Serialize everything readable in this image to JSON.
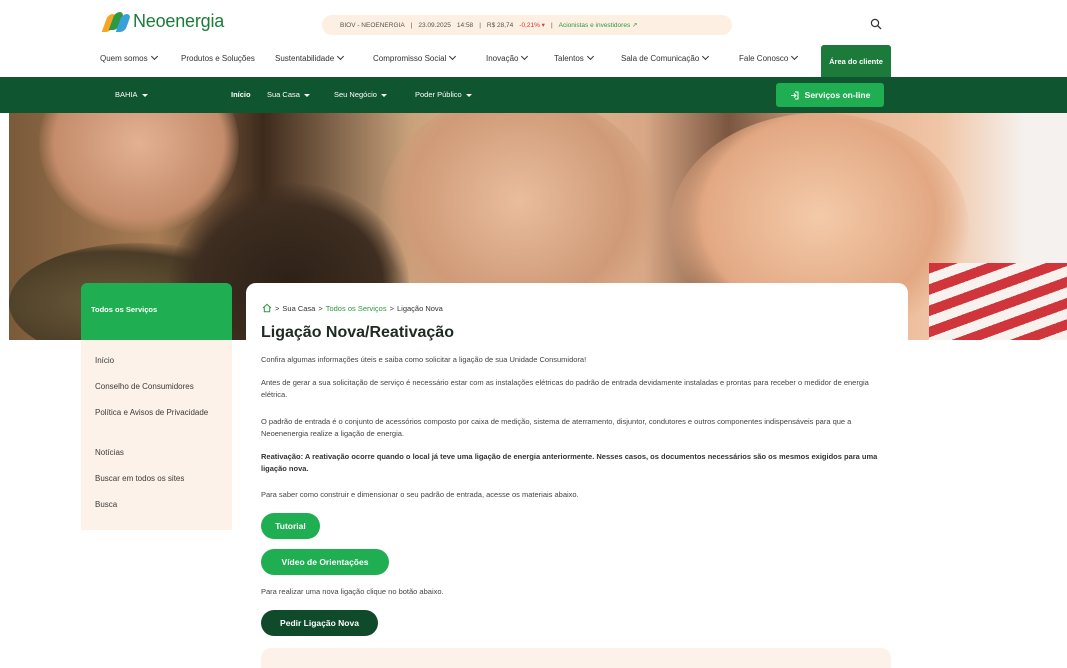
{
  "header": {
    "brand": "Neoenergia",
    "ticker": {
      "symbol": "BIOV - NEOENERGIA",
      "date": "23.09.2025",
      "time": "14:58",
      "price": "R$ 28,74",
      "change": "-0,21% ▾",
      "investors_link": "Acionistas e investidores ↗"
    },
    "nav": [
      {
        "label": "Quem somos"
      },
      {
        "label": "Produtos e Soluções"
      },
      {
        "label": "Sustentabilidade"
      },
      {
        "label": "Compromisso Social"
      },
      {
        "label": "Inovação"
      },
      {
        "label": "Talentos"
      },
      {
        "label": "Sala de Comunicação"
      },
      {
        "label": "Fale Conosco"
      }
    ],
    "area_cliente": "Área do cliente"
  },
  "region_bar": {
    "region": "BAHIA",
    "items": [
      {
        "label": "Início"
      },
      {
        "label": "Sua Casa"
      },
      {
        "label": "Seu Negócio"
      },
      {
        "label": "Poder Público"
      }
    ],
    "services_button": "Serviços on-line"
  },
  "sidebar": {
    "title": "Todos os Serviços",
    "items": [
      {
        "label": "Início"
      },
      {
        "label": "Conselho de Consumidores"
      },
      {
        "label": "Política e Avisos de Privacidade"
      },
      {
        "label": "Notícias"
      },
      {
        "label": "Buscar em todos os sites"
      },
      {
        "label": "Busca"
      }
    ]
  },
  "content": {
    "breadcrumb": {
      "sep": ">",
      "sua_casa": "Sua Casa",
      "todos": "Todos os Serviços",
      "current": "Ligação Nova"
    },
    "title": "Ligação Nova/Reativação",
    "p1": "Confira algumas informações úteis e saiba como solicitar a ligação de sua Unidade Consumidora!",
    "p2": "Antes de gerar a sua solicitação de serviço é necessário estar com as instalações elétricas do padrão de entrada devidamente instaladas e prontas para receber o medidor de energia elétrica.",
    "p3": "O padrão de entrada é o conjunto de acessórios composto por caixa de medição, sistema de aterramento, disjuntor, condutores e outros componentes indispensáveis para que a Neoenenergia realize a ligação de energia.",
    "p4": "Reativação: A reativação ocorre quando o local já teve uma ligação de energia anteriormente. Nesses casos, os documentos necessários são os mesmos exigidos para uma ligação nova.",
    "p5": "Para saber como construir e dimensionar o seu padrão de entrada, acesse os materiais abaixo.",
    "btn_tutorial": "Tutorial",
    "btn_video": "Vídeo de Orientações",
    "p6": "Para realizar uma nova ligação clique no botão abaixo.",
    "btn_pedir": "Pedir Ligação Nova"
  },
  "colors": {
    "brand_green": "#1fae52",
    "dark_green": "#0f5530",
    "accent_peach": "#fdf2e9"
  }
}
